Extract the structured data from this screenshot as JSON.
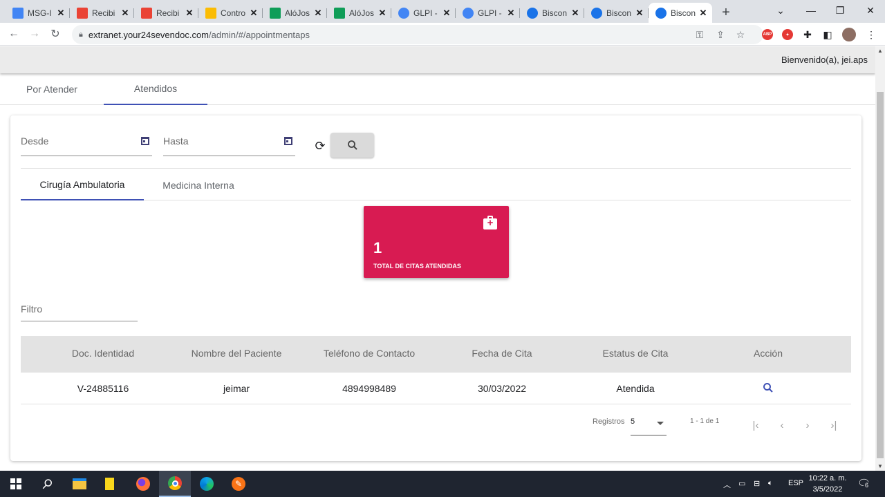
{
  "browser": {
    "tabs": [
      {
        "title": "MSG-I",
        "icon": "docs-icon",
        "color": "#4285f4",
        "active": false
      },
      {
        "title": "Recibi",
        "icon": "gmail-icon",
        "color": "#ea4335",
        "active": false
      },
      {
        "title": "Recibi",
        "icon": "gmail-icon",
        "color": "#ea4335",
        "active": false
      },
      {
        "title": "Contro",
        "icon": "drive-icon",
        "color": "#fbbc04",
        "active": false
      },
      {
        "title": "AlóJos",
        "icon": "sheets-plus-icon",
        "color": "#0f9d58",
        "active": false
      },
      {
        "title": "AlóJos",
        "icon": "sheets-plus-icon",
        "color": "#0f9d58",
        "active": false
      },
      {
        "title": "GLPI -",
        "icon": "glpi-icon",
        "color": "#4285f4",
        "active": false
      },
      {
        "title": "GLPI -",
        "icon": "glpi-icon",
        "color": "#4285f4",
        "active": false
      },
      {
        "title": "Biscon",
        "icon": "biscon-icon",
        "color": "#1a73e8",
        "active": false
      },
      {
        "title": "Biscon",
        "icon": "biscon-icon",
        "color": "#1a73e8",
        "active": false
      },
      {
        "title": "Biscon",
        "icon": "biscon-icon",
        "color": "#1a73e8",
        "active": true
      }
    ],
    "tab_close": "✕",
    "new_tab": "+",
    "url_host": "extranet.your24sevendoc.com",
    "url_path": "/admin/#/appointmentaps",
    "ext_abp": "ABP",
    "ext_red": "✦"
  },
  "app": {
    "welcome": "Bienvenido(a), jei.aps",
    "main_tabs": [
      "Por Atender",
      "Atendidos"
    ],
    "filters": {
      "desde": "Desde",
      "hasta": "Hasta"
    },
    "sub_tabs": [
      "Cirugía Ambulatoria",
      "Medicina Interna"
    ],
    "stat_card": {
      "value": "1",
      "label": "TOTAL DE CITAS ATENDIDAS",
      "color": "#d81b52"
    },
    "filter_label": "Filtro",
    "table": {
      "headers": [
        "Doc. Identidad",
        "Nombre del Paciente",
        "Teléfono de Contacto",
        "Fecha de Cita",
        "Estatus de Cita",
        "Acción"
      ],
      "rows": [
        [
          "V-24885116",
          "jeimar",
          "4894998489",
          "30/03/2022",
          "Atendida"
        ]
      ]
    },
    "paginator": {
      "label": "Registros",
      "page_size": "5",
      "range": "1 - 1 de 1"
    },
    "accent": "#3f51b5"
  },
  "taskbar": {
    "language": "ESP",
    "time": "10:22 a. m.",
    "date": "3/5/2022",
    "notifications": "6"
  }
}
